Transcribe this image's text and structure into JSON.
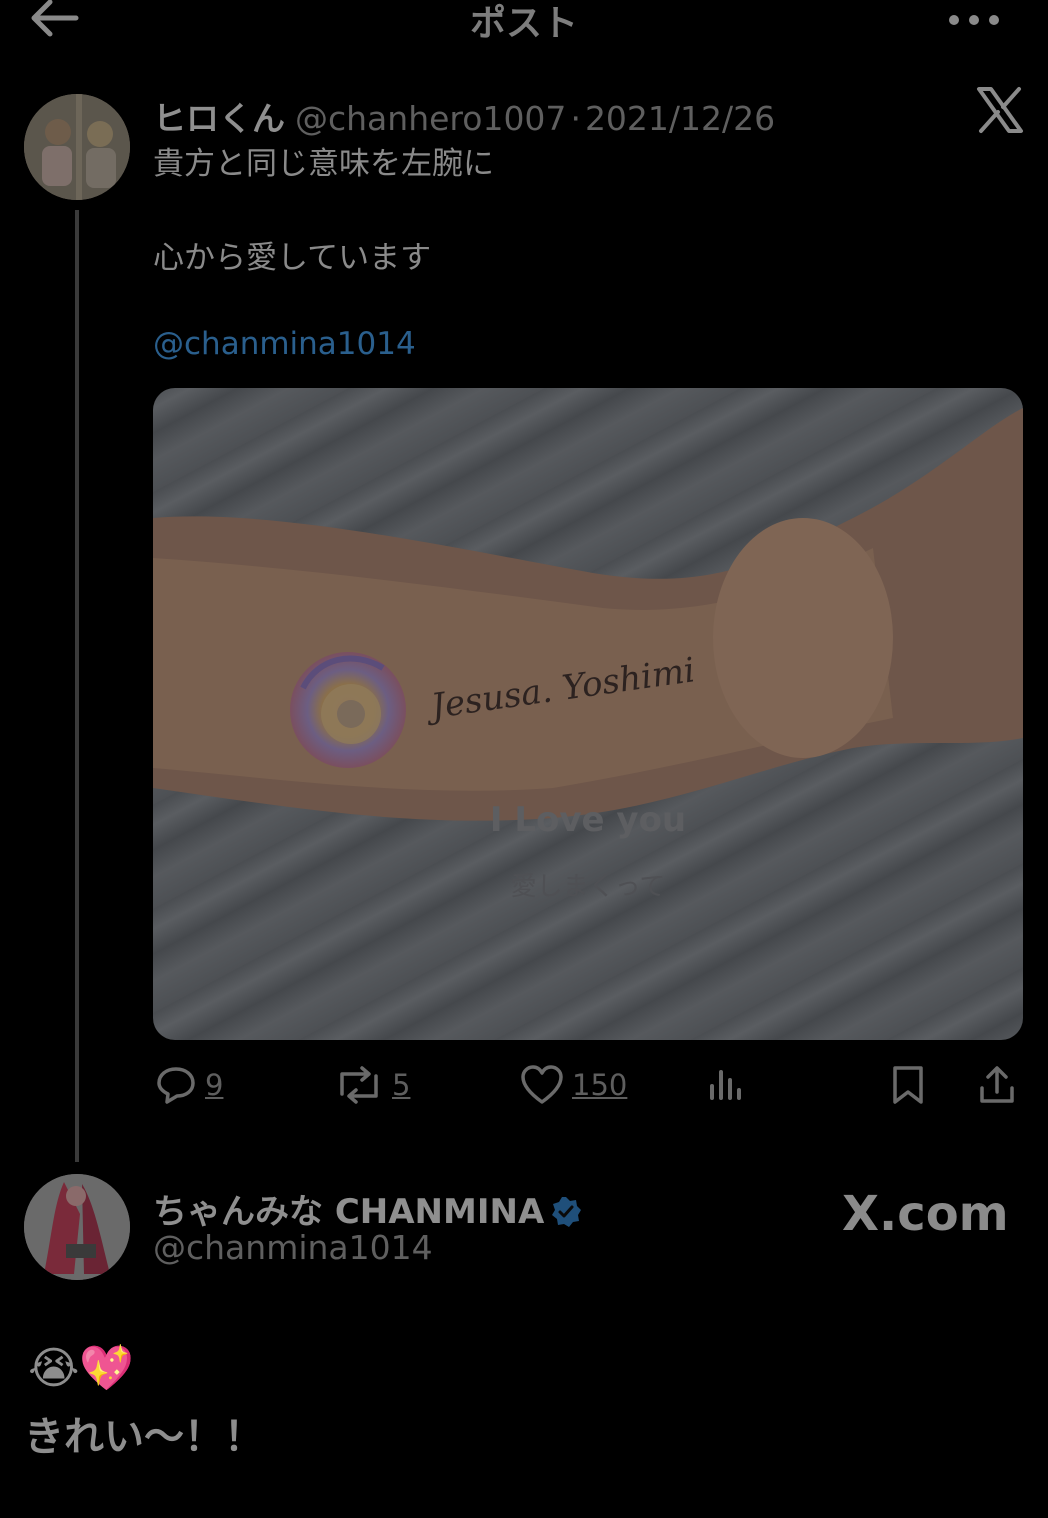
{
  "header": {
    "title": "ポスト"
  },
  "post": {
    "author_name": "ヒロくん",
    "author_handle": "@chanhero1007",
    "date": "2021/12/26",
    "text_line1": "貴方と同じ意味を左腕に",
    "text_line2": "心から愛しています",
    "mention": "@chanmina1014",
    "media": {
      "tattoo_script": "Jesusa. Yoshimi",
      "caption_line1": "I Love you",
      "caption_line2": "愛しまくって"
    },
    "stats": {
      "replies": "9",
      "reposts": "5",
      "likes": "150"
    }
  },
  "reply": {
    "author_name": "ちゃんみな CHANMINA",
    "author_handle": "@chanmina1014",
    "emojis": "😭💖",
    "text": "きれい〜！！"
  },
  "watermark": "X.com",
  "colors": {
    "background": "#000000",
    "mention": "#2a5f8d",
    "verified": "#1f4f7a"
  }
}
